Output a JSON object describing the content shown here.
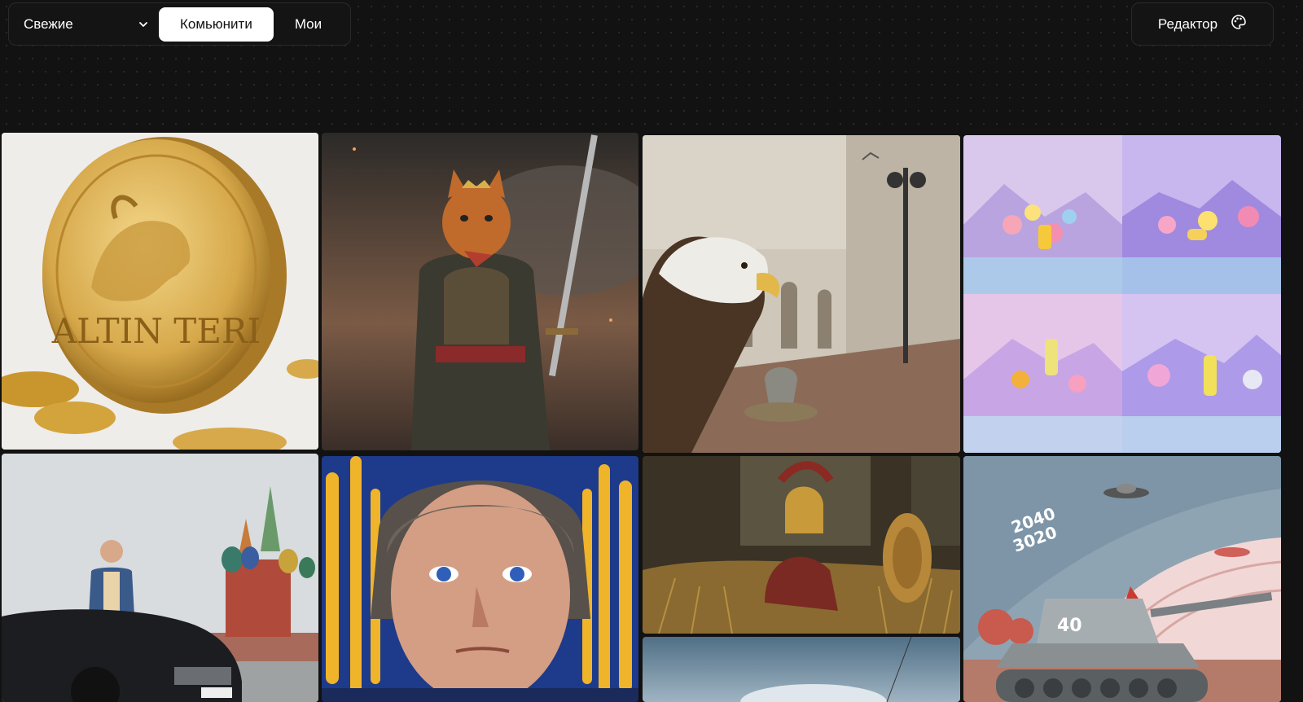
{
  "filters": {
    "sort_label": "Свежие",
    "tabs": [
      {
        "label": "Комьюнити",
        "active": true
      },
      {
        "label": "Мои",
        "active": false
      }
    ]
  },
  "editor": {
    "label": "Редактор"
  },
  "gallery": {
    "coin_text": "ALTIN TERI",
    "poster_years_top": "2040",
    "poster_years_bottom": "3020",
    "tank_number": "40"
  },
  "colors": {
    "background": "#121212",
    "active_tab": "#ffffff",
    "active_tab_text": "#111111"
  },
  "icons": {
    "chevron": "chevron-down-icon",
    "editor": "palette-icon"
  }
}
